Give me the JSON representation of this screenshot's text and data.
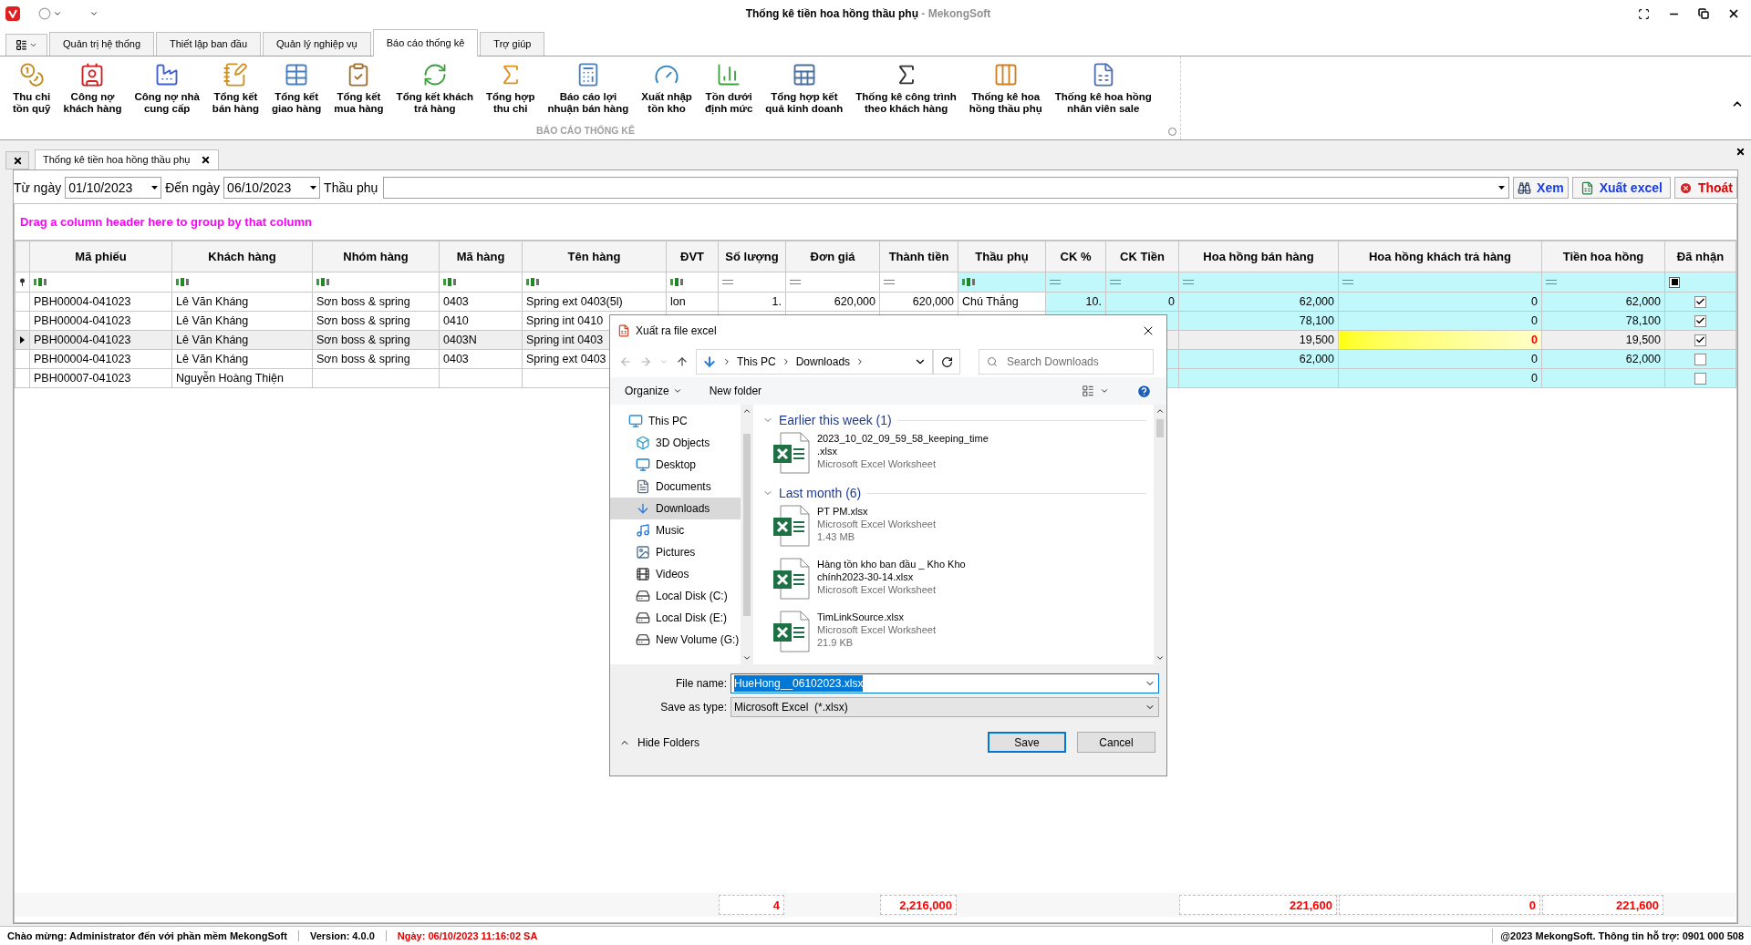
{
  "window": {
    "title": "Thống kê tiền hoa hồng thầu phụ",
    "app_name": " - MekongSoft"
  },
  "ribbon": {
    "tabs": [
      {
        "label": "Quản trị hệ thống",
        "selected": false
      },
      {
        "label": "Thiết lập ban đầu",
        "selected": false
      },
      {
        "label": "Quản lý nghiệp vụ",
        "selected": false
      },
      {
        "label": "Báo cáo thống kê",
        "selected": true
      },
      {
        "label": "Trợ giúp",
        "selected": false
      }
    ],
    "group_label": "BÁO CÁO THỐNG KÊ",
    "buttons": [
      {
        "lines": [
          "Thu chi",
          "tồn quỹ"
        ]
      },
      {
        "lines": [
          "Công nợ",
          "khách hàng"
        ]
      },
      {
        "lines": [
          "Công nợ nhà",
          "cung cấp"
        ]
      },
      {
        "lines": [
          "Tổng kết",
          "bán hàng"
        ]
      },
      {
        "lines": [
          "Tổng kết",
          "giao hàng"
        ]
      },
      {
        "lines": [
          "Tổng kết",
          "mua hàng"
        ]
      },
      {
        "lines": [
          "Tổng kết khách",
          "trả hàng"
        ]
      },
      {
        "lines": [
          "Tổng hợp",
          "thu chi"
        ]
      },
      {
        "lines": [
          "Báo cáo lợi",
          "nhuận bán hàng"
        ]
      },
      {
        "lines": [
          "Xuất nhập",
          "tồn kho"
        ]
      },
      {
        "lines": [
          "Tồn dưới",
          "định mức"
        ]
      },
      {
        "lines": [
          "Tổng hợp kết",
          "quả kinh doanh"
        ]
      },
      {
        "lines": [
          "Thống kê công trình",
          "theo khách hàng"
        ]
      },
      {
        "lines": [
          "Thống kê hoa",
          "hồng thầu phụ"
        ]
      },
      {
        "lines": [
          "Thống kê hoa hồng",
          "nhân viên sale"
        ]
      }
    ]
  },
  "document_tab": {
    "label": "Thống kê tiền hoa hồng thầu phụ"
  },
  "filters": {
    "from_label": "Từ ngày",
    "from_value": "01/10/2023",
    "to_label": "Đến ngày",
    "to_value": "06/10/2023",
    "subcontractor_label": "Thầu phụ"
  },
  "actions": [
    {
      "kind": "view",
      "label": "Xem"
    },
    {
      "kind": "export",
      "label": "Xuất excel"
    },
    {
      "kind": "exit",
      "label": "Thoát"
    }
  ],
  "group_panel_hint": "Drag a column header here to group by that column",
  "table": {
    "columns": [
      {
        "label": "Mã phiếu",
        "kind": "text"
      },
      {
        "label": "Khách hàng",
        "kind": "text"
      },
      {
        "label": "Nhóm hàng",
        "kind": "text"
      },
      {
        "label": "Mã hàng",
        "kind": "text"
      },
      {
        "label": "Tên hàng",
        "kind": "text"
      },
      {
        "label": "ĐVT",
        "kind": "text"
      },
      {
        "label": "Số lượng",
        "kind": "number"
      },
      {
        "label": "Đơn giá",
        "kind": "number"
      },
      {
        "label": "Thành tiền",
        "kind": "number"
      },
      {
        "label": "Thầu phụ",
        "kind": "text"
      },
      {
        "label": "CK %",
        "kind": "number"
      },
      {
        "label": "CK Tiền",
        "kind": "number"
      },
      {
        "label": "Hoa hồng bán hàng",
        "kind": "number"
      },
      {
        "label": "Hoa hồng khách trả hàng",
        "kind": "number"
      },
      {
        "label": "Tiền hoa hồng",
        "kind": "number"
      },
      {
        "label": "Đã nhận",
        "kind": "check",
        "filter_indeterminate": true
      }
    ],
    "rows": [
      {
        "selected": false,
        "received": true,
        "returns_flagged": false,
        "cells": [
          "PBH00004-041023",
          "Lê Văn Kháng",
          "Sơn boss & spring",
          "0403",
          "Spring ext 0403(5l)",
          "lon",
          "1.",
          "620,000",
          "620,000",
          "Chú Thắng",
          "10.",
          "0"
        ],
        "commission": {
          "sales": "62,000",
          "returns": "0",
          "total": "62,000"
        }
      },
      {
        "selected": false,
        "received": true,
        "returns_flagged": false,
        "cells": [
          "PBH00004-041023",
          "Lê Văn Kháng",
          "Sơn boss & spring",
          "0410",
          "Spring int 0410"
        ],
        "commission": {
          "sales": "78,100",
          "returns": "0",
          "total": "78,100"
        }
      },
      {
        "selected": true,
        "received": true,
        "returns_flagged": true,
        "cells": [
          "PBH00004-041023",
          "Lê Văn Kháng",
          "Sơn boss & spring",
          "0403N",
          "Spring int 0403"
        ],
        "commission": {
          "sales": "19,500",
          "returns": "0",
          "total": "19,500"
        }
      },
      {
        "selected": false,
        "received": false,
        "returns_flagged": false,
        "cells": [
          "PBH00004-041023",
          "Lê Văn Kháng",
          "Sơn boss & spring",
          "0403",
          "Spring ext 0403"
        ],
        "commission": {
          "sales": "62,000",
          "returns": "0",
          "total": "62,000"
        }
      },
      {
        "selected": false,
        "received": false,
        "returns_flagged": false,
        "cells": [
          "PBH00007-041023",
          "Nguyễn Hoàng Thiện"
        ],
        "commission": {
          "returns": "0"
        }
      }
    ],
    "totals": {
      "quantity": "4",
      "amount": "2,216,000",
      "commission": {
        "sales": "221,600",
        "returns": "0",
        "total": "221,600"
      }
    }
  },
  "status_bar": {
    "welcome": "Chào mừng: Administrator đến với phần mềm MekongSoft",
    "version": "Version: 4.0.0",
    "date": "Ngày: 06/10/2023 11:16:02 SA",
    "support": "@2023 MekongSoft. Thông tin hỗ trợ: 0901 000 508"
  },
  "dialog": {
    "title": "Xuất ra file excel",
    "breadcrumb": [
      "This PC",
      "Downloads"
    ],
    "search_placeholder": "Search Downloads",
    "organize": "Organize",
    "new_folder": "New folder",
    "nav": [
      {
        "label": "This PC",
        "selected": false,
        "children": [
          {
            "label": "3D Objects",
            "selected": false
          },
          {
            "label": "Desktop",
            "selected": false
          },
          {
            "label": "Documents",
            "selected": false
          },
          {
            "label": "Downloads",
            "selected": true
          },
          {
            "label": "Music",
            "selected": false
          },
          {
            "label": "Pictures",
            "selected": false
          },
          {
            "label": "Videos",
            "selected": false
          },
          {
            "label": "Local Disk (C:)",
            "selected": false
          },
          {
            "label": "Local Disk (E:)",
            "selected": false
          },
          {
            "label": "New Volume (G:)",
            "selected": false
          }
        ]
      }
    ],
    "groups": [
      {
        "label": "Earlier this week (1)",
        "files": [
          {
            "name_lines": [
              "2023_10_02_09_59_58_keeping_time",
              ".xlsx"
            ],
            "type": "Microsoft Excel Worksheet"
          }
        ]
      },
      {
        "label": "Last month (6)",
        "files": [
          {
            "name_lines": [
              "PT PM.xlsx"
            ],
            "type": "Microsoft Excel Worksheet",
            "size": "1.43 MB"
          },
          {
            "name_lines": [
              "Hàng tồn kho ban đầu _ Kho Kho",
              "chính2023-30-14.xlsx"
            ],
            "type": "Microsoft Excel Worksheet"
          },
          {
            "name_lines": [
              "TimLinkSource.xlsx"
            ],
            "type": "Microsoft Excel Worksheet",
            "size": "21.9 KB"
          }
        ]
      }
    ],
    "file_name_label": "File name:",
    "file_name": "HueHong__06102023.xlsx",
    "save_type_label": "Save as type:",
    "save_type": "Microsoft Excel  (*.xlsx)",
    "hide_folders": "Hide Folders",
    "save": "Save",
    "cancel": "Cancel"
  }
}
